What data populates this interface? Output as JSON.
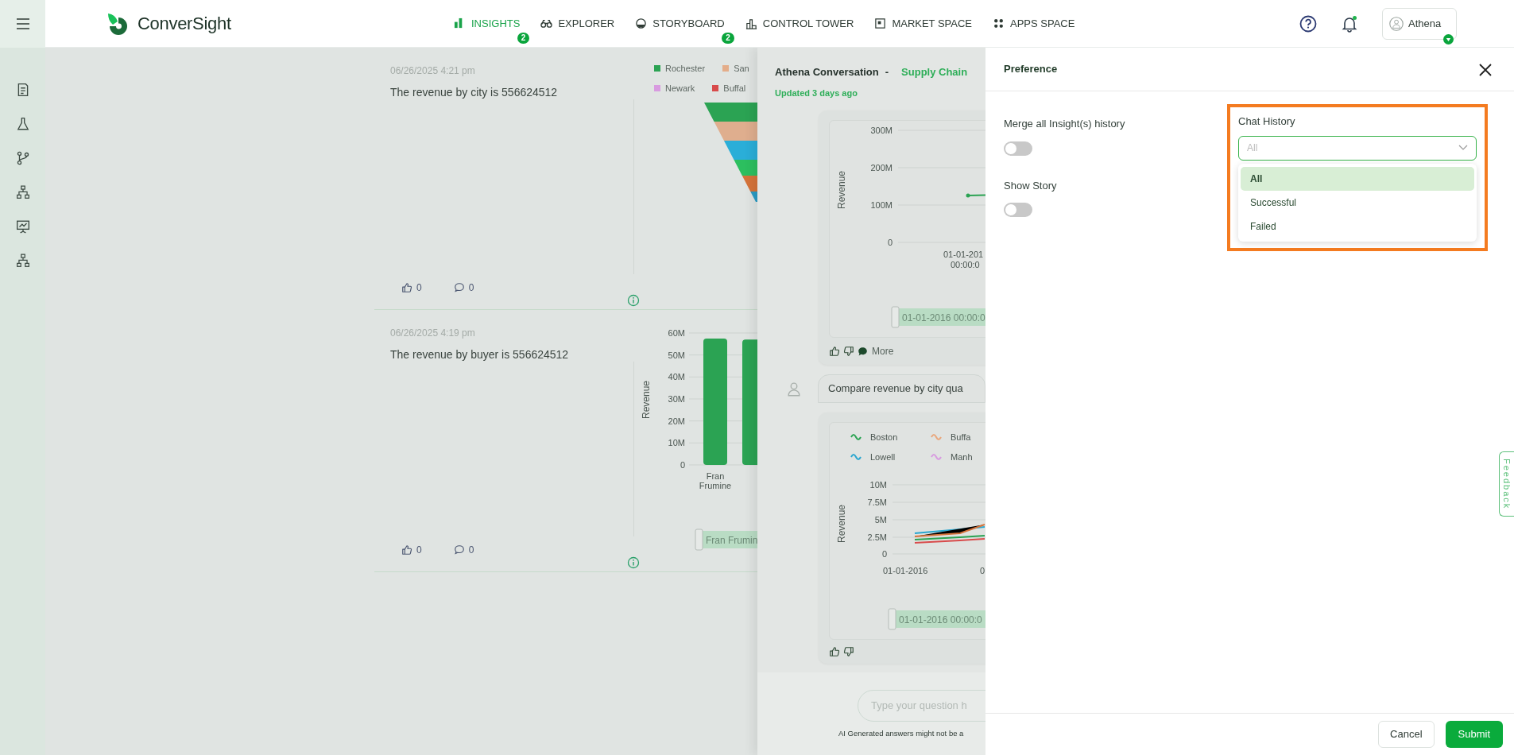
{
  "app": {
    "logo_text": "ConverSight"
  },
  "nav": [
    {
      "label": "INSIGHTS",
      "selected": true,
      "badge": "2"
    },
    {
      "label": "EXPLORER",
      "selected": false
    },
    {
      "label": "STORYBOARD",
      "selected": false,
      "badge": "2"
    },
    {
      "label": "CONTROL TOWER",
      "selected": false
    },
    {
      "label": "MARKET SPACE",
      "selected": false
    },
    {
      "label": "APPS SPACE",
      "selected": false
    }
  ],
  "notifications": {
    "unread": true
  },
  "user": {
    "name": "Athena"
  },
  "insights": [
    {
      "date": "06/26/2025 4:21 pm",
      "text": "The revenue by city is 556624512",
      "likes": "0",
      "comments": "0",
      "chart": {
        "kind": "funnel",
        "legend": [
          {
            "label": "Rochester",
            "color": "#2ba353"
          },
          {
            "label": "San",
            "color": "#e4ad8a"
          },
          {
            "label": "Newark",
            "color": "#d89be0"
          },
          {
            "label": "Buffal",
            "color": "#d84b4b"
          }
        ]
      }
    },
    {
      "date": "06/26/2025 4:19 pm",
      "text": "The revenue by buyer is 556624512",
      "likes": "0",
      "comments": "0",
      "chart": {
        "kind": "bar",
        "slider": {
          "label": "Fran Frumin",
          "level": 1
        },
        "chart_data": {
          "type": "bar",
          "ylabel": "Revenue",
          "grid": true,
          "categories": [
            "Fran Frumine",
            null
          ],
          "values": [
            57500000,
            57000000
          ],
          "ylim": [
            0,
            60000000
          ],
          "yticks": [
            {
              "value": 0,
              "label": "0"
            },
            {
              "value": 10000000,
              "label": "10M"
            },
            {
              "value": 20000000,
              "label": "20M"
            },
            {
              "value": 30000000,
              "label": "30M"
            },
            {
              "value": 40000000,
              "label": "40M"
            },
            {
              "value": 50000000,
              "label": "50M"
            },
            {
              "value": 60000000,
              "label": "60M"
            }
          ]
        }
      }
    }
  ],
  "conversation": {
    "title": "Athena Conversation",
    "separator": "-",
    "project": "Supply Chain",
    "updated": "Updated 3 days ago",
    "messages": [
      {
        "kind": "answer",
        "chart": {
          "kind": "line",
          "ylabel": "Revenue",
          "yticks": [
            "300M",
            "200M",
            "100M",
            "0"
          ],
          "xtick": "01-01-201",
          "xtick_time": "00:00:0",
          "slider": {
            "label": "01-01-2016 00:00:0",
            "level": 1
          }
        },
        "more": "More"
      },
      {
        "kind": "question",
        "text": "Compare revenue by city qua"
      },
      {
        "kind": "answer",
        "chart": {
          "kind": "multiline",
          "ylabel": "Revenue",
          "legend": [
            {
              "label": "Boston",
              "color": "#2ba353"
            },
            {
              "label": "Buffa",
              "color": "#e9a77c"
            },
            {
              "label": "Lowell",
              "color": "#2aa6cf"
            },
            {
              "label": "Manh",
              "color": "#d89be0"
            }
          ],
          "yticks": [
            "10M",
            "7.5M",
            "5M",
            "2.5M",
            "0"
          ],
          "xticks": [
            "01-01-2016",
            "0"
          ],
          "slider": {
            "label": "01-01-2016 00:00:0",
            "level": 1
          }
        }
      }
    ],
    "input": {
      "placeholder": "Type your question h"
    },
    "disclaimer": "AI Generated answers might not be a"
  },
  "preference": {
    "title": "Preference",
    "settings": [
      {
        "label": "Merge all Insight(s) history",
        "on": false
      },
      {
        "label": "Show Story",
        "on": false
      }
    ],
    "chat_history": {
      "label": "Chat History",
      "placeholder": "All",
      "highlighted": true,
      "expanded": true,
      "options": [
        {
          "label": "All",
          "selected": true
        },
        {
          "label": "Successful",
          "selected": false
        },
        {
          "label": "Failed",
          "selected": false
        }
      ]
    },
    "cancel": "Cancel",
    "submit": "Submit"
  },
  "feedback_tab": "Feedback"
}
